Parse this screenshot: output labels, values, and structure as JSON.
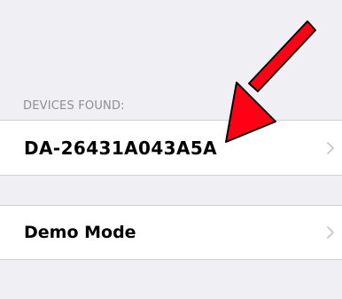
{
  "section": {
    "header": "DEVICES FOUND:"
  },
  "devices": [
    {
      "label": "DA-26431A043A5A",
      "chevron_icon": "chevron-right-icon"
    }
  ],
  "demo": {
    "label": "Demo Mode",
    "chevron_icon": "chevron-right-icon"
  },
  "annotation": {
    "type": "arrow",
    "color": "#ff0015",
    "outline_color": "#000000"
  },
  "colors": {
    "background": "#efeff4",
    "cell_background": "#ffffff",
    "separator": "#d1d1d6",
    "header_text": "#8e8e93",
    "chevron": "#c7c7cc"
  }
}
